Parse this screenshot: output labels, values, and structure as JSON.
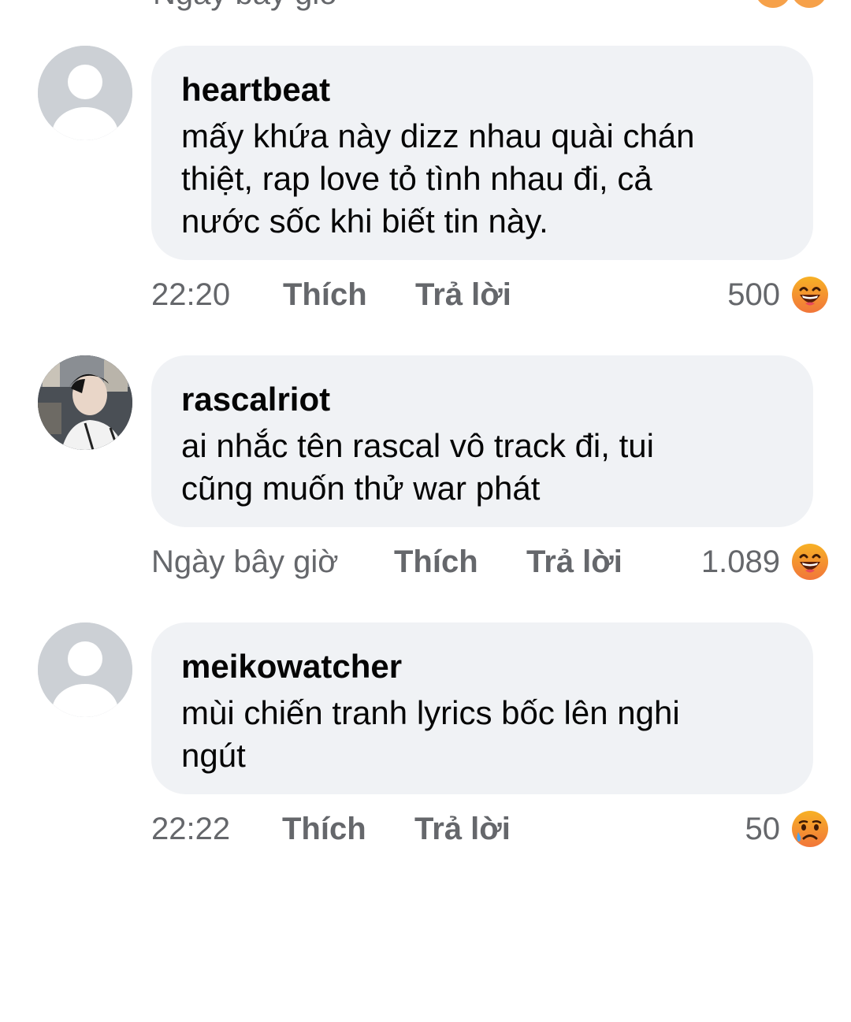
{
  "partial_top": {
    "time": "Ngày bây giờ"
  },
  "comments": [
    {
      "author": "heartbeat",
      "text": "mấy khứa này dizz nhau quài chán\nthiệt, rap love tỏ tình nhau đi, cả\nnước sốc khi biết tin này.",
      "time": "22:20",
      "like_label": "Thích",
      "reply_label": "Trả lời",
      "reaction_count": "500",
      "reaction_icon": "laughing-emoji-icon",
      "avatar": "default-avatar-icon"
    },
    {
      "author": "rascalriot",
      "text": "ai nhắc tên rascal vô track đi, tui\ncũng muốn thử war phát",
      "time": "Ngày bây giờ",
      "like_label": "Thích",
      "reply_label": "Trả lời",
      "reaction_count": "1.089",
      "reaction_icon": "laughing-emoji-icon",
      "avatar": "profile-photo"
    },
    {
      "author": "meikowatcher",
      "text": "mùi chiến tranh lyrics bốc lên nghi\nngút",
      "time": "22:22",
      "like_label": "Thích",
      "reply_label": "Trả lời",
      "reaction_count": "50",
      "reaction_icon": "sad-emoji-icon",
      "avatar": "default-avatar-icon"
    }
  ],
  "colors": {
    "bubble_bg": "#f0f2f5",
    "meta_text": "#65676b",
    "body_text": "#050505",
    "avatar_placeholder": "#ccd0d5",
    "emoji_yellow": "#f7b125",
    "emoji_orange": "#f1763a"
  }
}
